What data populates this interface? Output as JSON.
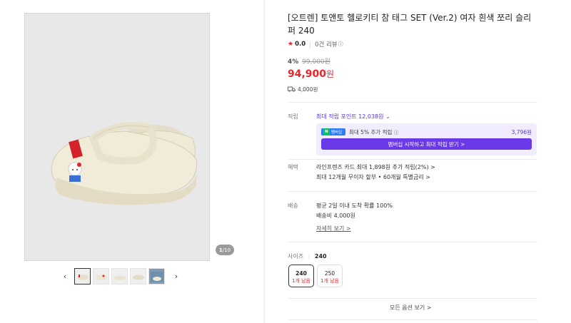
{
  "gallery": {
    "counter_current": "1",
    "counter_total": "/10",
    "prev_icon": "chevron-left-icon",
    "next_icon": "chevron-right-icon"
  },
  "product": {
    "title": "[오트렌] 토앤토 헬로키티 참 태그 SET (Ver.2) 여자 흰색 쪼리 슬리퍼 240",
    "rating": "0.0",
    "review_count": "0건 리뷰",
    "discount": "4%",
    "original_price": "99,000원",
    "final_price": "94,900",
    "currency": "원",
    "shipping_fee": "4,000원"
  },
  "points": {
    "label": "적립",
    "max_points": "최대 적립 포인트 12,038원",
    "np_badge": "N",
    "np_badge_text": "멤버십",
    "np_text": "최대 5% 추가 적립",
    "np_amount": "3,796원",
    "np_button": "멤버십 시작하고 최대 적립 받기 >"
  },
  "benefits": {
    "label": "혜택",
    "line1": "라인프렌즈 카드 최대 1,898원 추가 적립(2%) >",
    "line2": "최대 12개월 무이자 할부 • 60개월 특별금리 >"
  },
  "delivery": {
    "label": "배송",
    "line1": "평균 2일 이내 도착 확률 100%",
    "line2": "배송비 4,000원",
    "details_link": "자세히 보기 >"
  },
  "size": {
    "label": "사이즈",
    "selected": "240",
    "options": [
      {
        "size": "240",
        "stock": "1개 남음"
      },
      {
        "size": "250",
        "stock": "1개 남음"
      }
    ]
  },
  "all_options": "모든 옵션 보기 >",
  "colors": {
    "accent_red": "#e4262e",
    "accent_purple": "#6a3ae8",
    "naverpay_green": "#03c75a"
  }
}
